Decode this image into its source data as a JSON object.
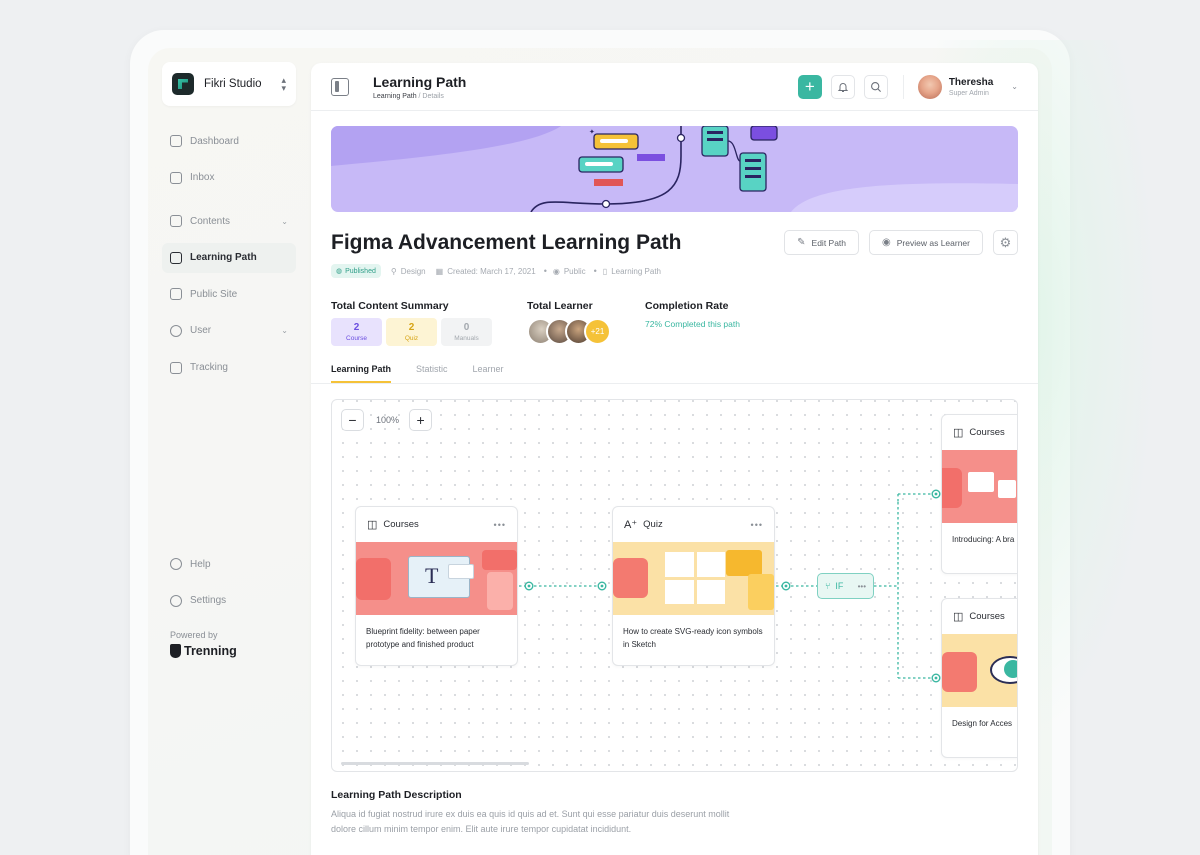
{
  "workspace": {
    "name": "Fikri Studio"
  },
  "sidebar": {
    "items": [
      {
        "label": "Dashboard",
        "icon": "dashboard-icon"
      },
      {
        "label": "Inbox",
        "icon": "inbox-icon"
      },
      {
        "label": "Contents",
        "icon": "contents-icon"
      },
      {
        "label": "Learning Path",
        "icon": "learning-path-icon"
      },
      {
        "label": "Public Site",
        "icon": "public-site-icon"
      },
      {
        "label": "User",
        "icon": "user-icon"
      },
      {
        "label": "Tracking",
        "icon": "tracking-icon"
      }
    ],
    "bottom": [
      {
        "label": "Help",
        "icon": "help-icon"
      },
      {
        "label": "Settings",
        "icon": "settings-icon"
      }
    ],
    "powered_by": "Powered by",
    "brand": "Trenning"
  },
  "header": {
    "title": "Learning Path",
    "breadcrumb": [
      "Learning Path",
      "/ Details"
    ],
    "user_name": "Theresha",
    "user_role": "Super Admin"
  },
  "page": {
    "title": "Figma Advancement Learning Path",
    "edit_label": "Edit Path",
    "preview_label": "Preview as Learner",
    "status": "Published",
    "meta": [
      "Design",
      "Created: March 17, 2021",
      "Public",
      "Learning Path"
    ]
  },
  "summary": {
    "content_title": "Total Content Summary",
    "chips": [
      {
        "value": "2",
        "label": "Course"
      },
      {
        "value": "2",
        "label": "Quiz"
      },
      {
        "value": "0",
        "label": "Manuals"
      }
    ],
    "learner_title": "Total Learner",
    "learner_more": "+21",
    "completion_title": "Completion Rate",
    "completion_text": "72% Completed this path"
  },
  "tabs": [
    "Learning Path",
    "Statistic",
    "Learner"
  ],
  "canvas": {
    "zoom": "100%",
    "if_label": "IF",
    "cards": [
      {
        "type": "Courses",
        "text": "Blueprint fidelity: between paper prototype and finished product"
      },
      {
        "type": "Quiz",
        "text": "How to create SVG-ready icon symbols in Sketch"
      },
      {
        "type": "Courses",
        "text": "Introducing: A bra"
      },
      {
        "type": "Courses",
        "text": "Design for Acces"
      }
    ]
  },
  "description": {
    "title": "Learning Path Description",
    "text": "Aliqua id fugiat nostrud irure ex duis ea quis id quis ad et. Sunt qui esse pariatur duis deserunt mollit dolore cillum minim tempor enim. Elit aute irure tempor cupidatat incididunt."
  },
  "colors": {
    "accent": "#3ab7a1",
    "banner": "#c7b9f7",
    "highlight": "#f5c238"
  }
}
